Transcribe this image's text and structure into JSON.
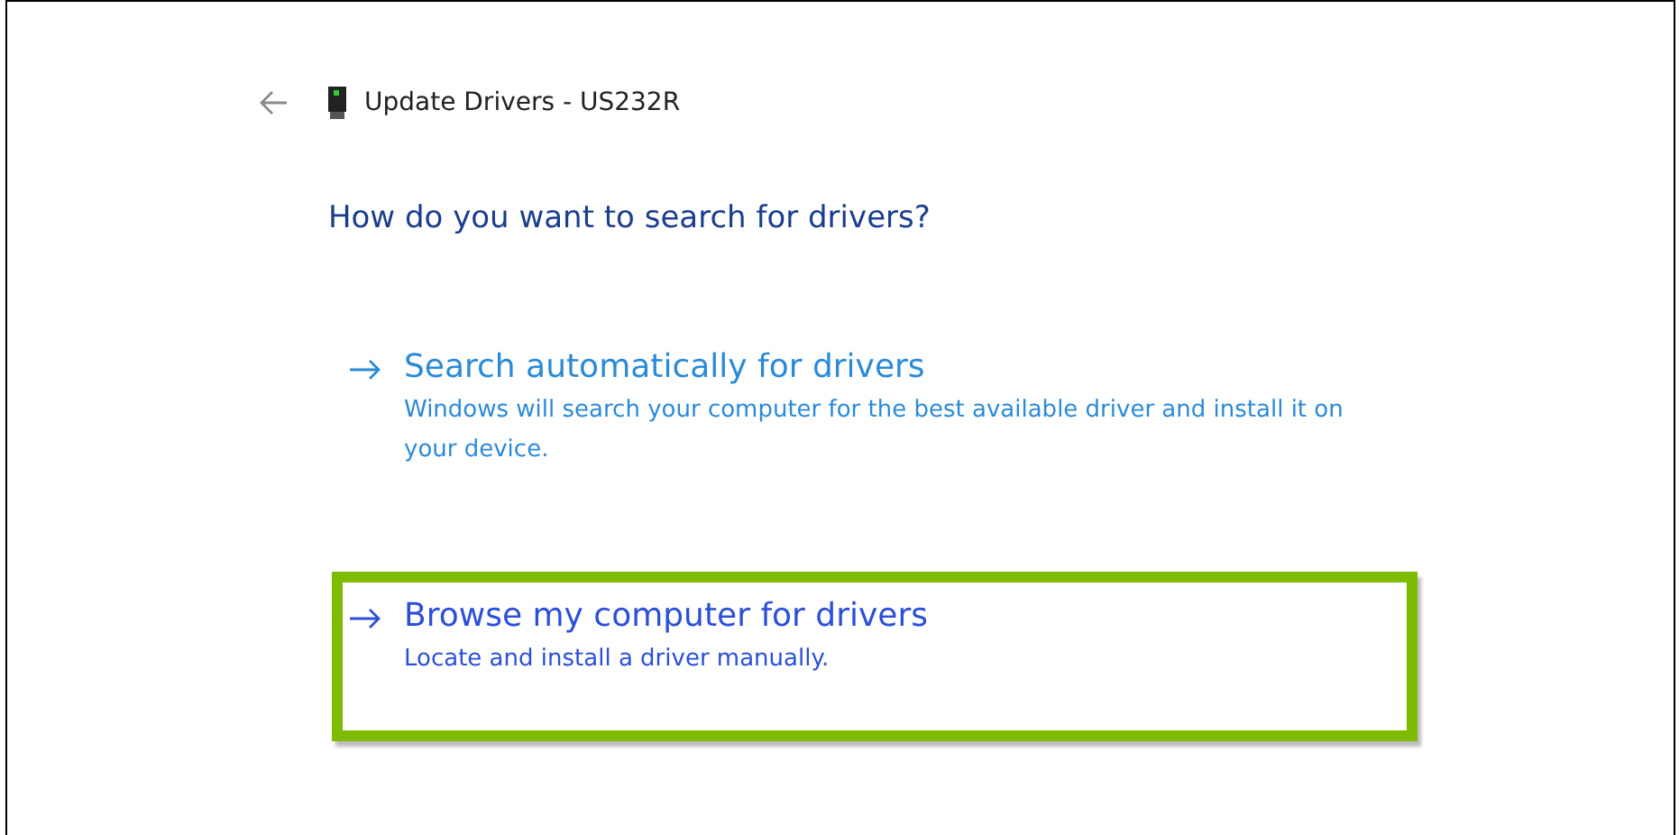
{
  "header": {
    "title": "Update Drivers - US232R"
  },
  "heading": "How do you want to search for drivers?",
  "options": [
    {
      "title": "Search automatically for drivers",
      "description": "Windows will search your computer for the best available driver and install it on your device.",
      "highlighted": false
    },
    {
      "title": "Browse my computer for drivers",
      "description": "Locate and install a driver manually.",
      "highlighted": true
    }
  ]
}
